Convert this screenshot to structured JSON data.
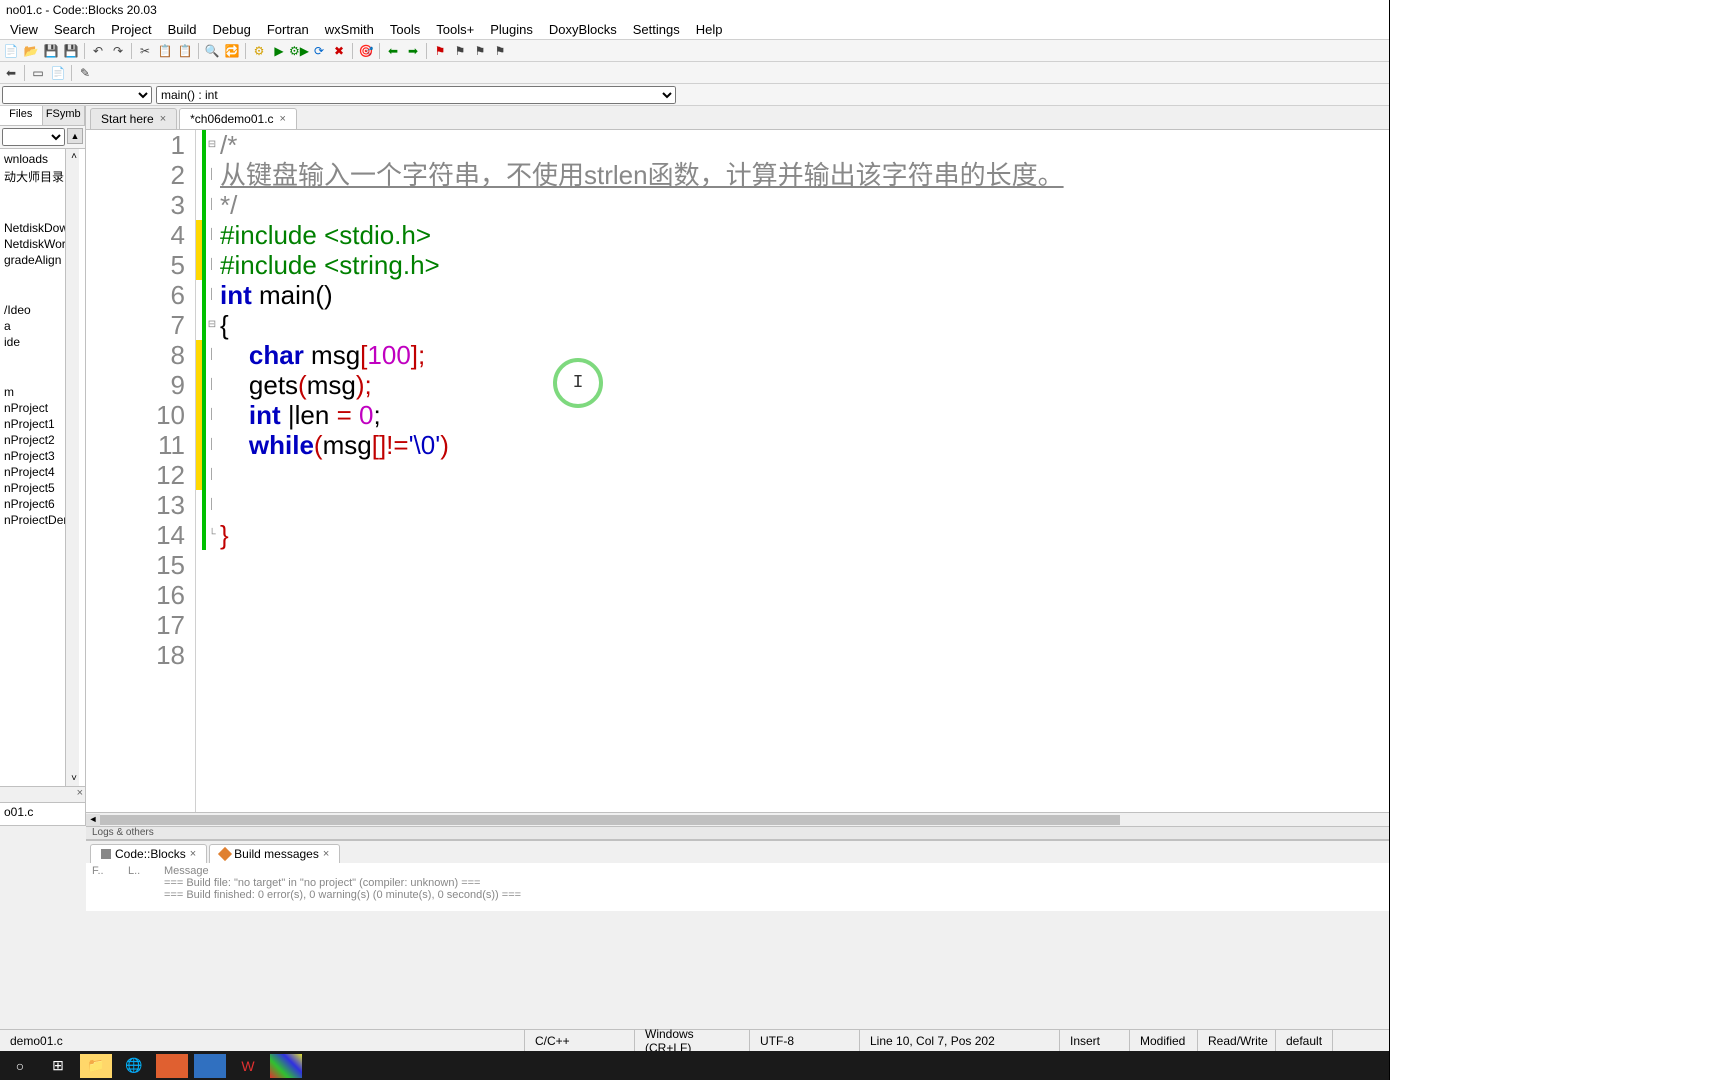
{
  "window": {
    "title": "no01.c - Code::Blocks 20.03"
  },
  "menu": [
    "View",
    "Search",
    "Project",
    "Build",
    "Debug",
    "Fortran",
    "wxSmith",
    "Tools",
    "Tools+",
    "Plugins",
    "DoxyBlocks",
    "Settings",
    "Help"
  ],
  "funcbar": {
    "scope": "",
    "func": "main() : int"
  },
  "sidebar": {
    "tabs": [
      "Files",
      "FSymb"
    ],
    "items": [
      "wnloads",
      "动大师目录",
      "",
      "NetdiskDow",
      "NetdiskWorl",
      "gradeAlign",
      "",
      "/Ideo",
      "a",
      "ide",
      "",
      "m",
      "nProject",
      "nProject1",
      "nProject2",
      "nProject3",
      "nProject4",
      "nProject5",
      "nProject6",
      "nProiectDen"
    ],
    "bottom": "o01.c"
  },
  "tabs": [
    {
      "label": "Start here",
      "active": false
    },
    {
      "label": "*ch06demo01.c",
      "active": true
    }
  ],
  "code": {
    "lines": 18,
    "l1": "/*",
    "l2": "从键盘输入一个字符串，不使用strlen函数，计算并输出该字符串的长度。",
    "l3": "*/",
    "l4a": "#include ",
    "l4b": "<stdio.h>",
    "l5a": "#include ",
    "l5b": "<string.h>",
    "l6a": "int",
    "l6b": " main",
    "l6c": "()",
    "l7": "{",
    "l8a": "    ",
    "l8b": "char",
    "l8c": " msg",
    "l8d": "[",
    "l8e": "100",
    "l8f": "];",
    "l9a": "    gets",
    "l9b": "(",
    "l9c": "msg",
    "l9d": ");",
    "l10a": "    ",
    "l10b": "int",
    "l10c": " |len ",
    "l10d": "=",
    "l10e": " ",
    "l10f": "0",
    "l10g": ";",
    "l11a": "    ",
    "l11b": "while",
    "l11c": "(",
    "l11d": "msg",
    "l11e": "[]!=",
    "l11f": "'\\0'",
    "l11g": ")",
    "l14": "}"
  },
  "logs": {
    "header": "Logs & others",
    "tabs": [
      {
        "label": "Code::Blocks",
        "icon": "g"
      },
      {
        "label": "Build messages",
        "icon": "o"
      }
    ],
    "cols": [
      "F..",
      "L..",
      "Message"
    ],
    "line1": "=== Build file: \"no target\" in \"no project\" (compiler: unknown) ===",
    "line2": "=== Build finished: 0 error(s), 0 warning(s) (0 minute(s), 0 second(s)) ==="
  },
  "status": {
    "file": "demo01.c",
    "lang": "C/C++",
    "eol": "Windows (CR+LF)",
    "enc": "UTF-8",
    "pos": "Line 10, Col 7, Pos 202",
    "ins": "Insert",
    "mod": "Modified",
    "rw": "Read/Write",
    "prof": "default"
  }
}
